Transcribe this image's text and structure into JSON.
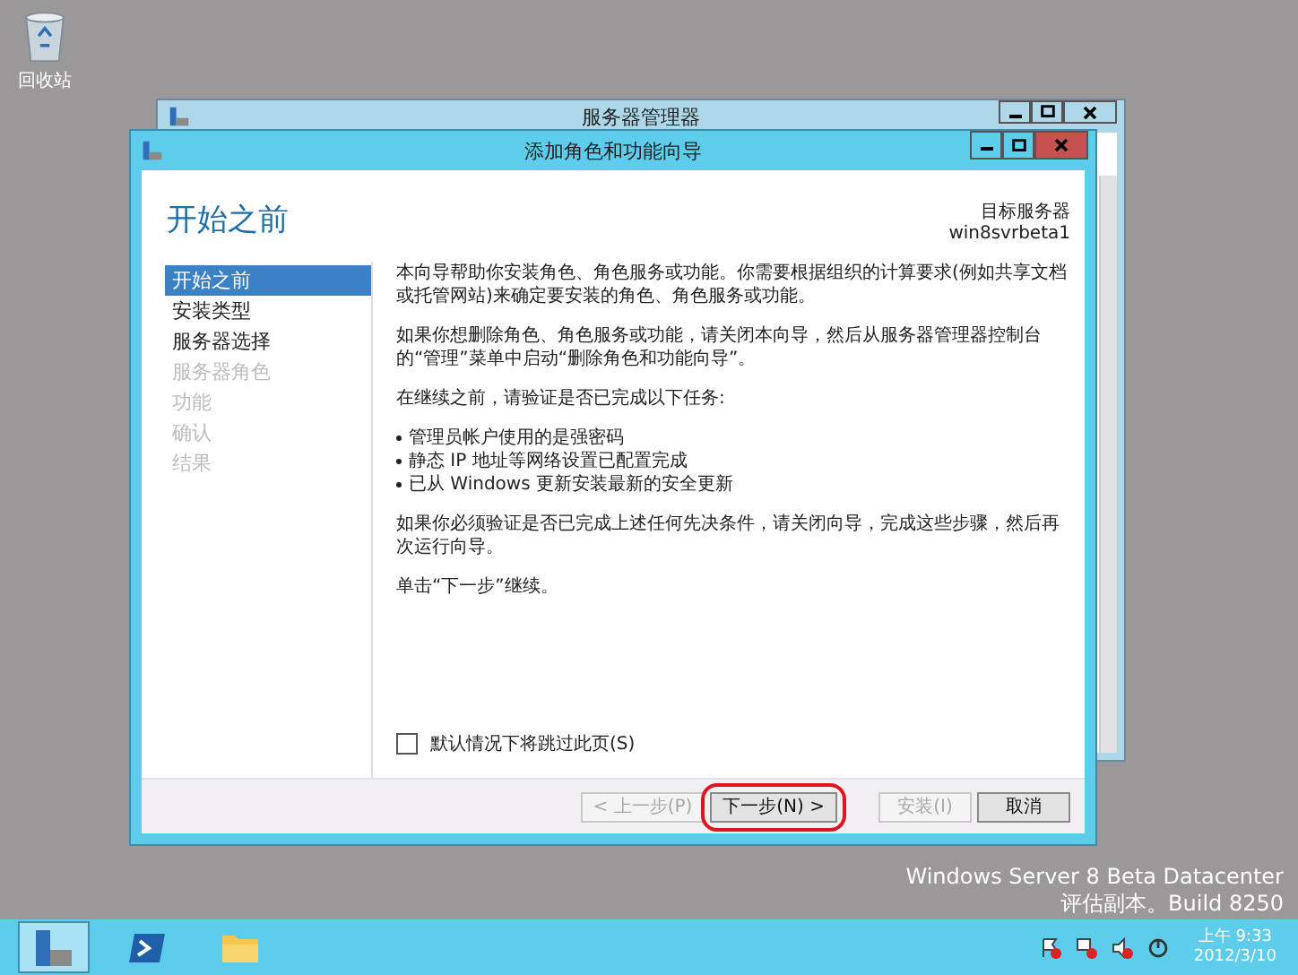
{
  "desktop": {
    "icons": [
      {
        "label": "回收站"
      }
    ]
  },
  "back_window": {
    "title": "服务器管理器"
  },
  "wizard": {
    "title": "添加角色和功能向导",
    "heading": "开始之前",
    "target_label": "目标服务器",
    "target_value": "win8svrbeta1",
    "nav": [
      {
        "label": "开始之前",
        "selected": true,
        "disabled": false
      },
      {
        "label": "安装类型",
        "selected": false,
        "disabled": false
      },
      {
        "label": "服务器选择",
        "selected": false,
        "disabled": false
      },
      {
        "label": "服务器角色",
        "selected": false,
        "disabled": true
      },
      {
        "label": "功能",
        "selected": false,
        "disabled": true
      },
      {
        "label": "确认",
        "selected": false,
        "disabled": true
      },
      {
        "label": "结果",
        "selected": false,
        "disabled": true
      }
    ],
    "content": [
      {
        "kind": "paragraph",
        "text": "本向导帮助你安装角色、角色服务或功能。你需要根据组织的计算要求(例如共享文档或托管网站)来确定要安装的角色、角色服务或功能。"
      },
      {
        "kind": "paragraph",
        "text": "如果你想删除角色、角色服务或功能，请关闭本向导，然后从服务器管理器控制台的“管理”菜单中启动“删除角色和功能向导”。"
      },
      {
        "kind": "paragraph",
        "text": "在继续之前，请验证是否已完成以下任务:"
      },
      {
        "kind": "bullets",
        "items": [
          "管理员帐户使用的是强密码",
          "静态 IP 地址等网络设置已配置完成",
          "已从 Windows 更新安装最新的安全更新"
        ]
      },
      {
        "kind": "paragraph",
        "text": "如果你必须验证是否已完成上述任何先决条件，请关闭向导，完成这些步骤，然后再次运行向导。"
      },
      {
        "kind": "paragraph",
        "text": "单击“下一步”继续。"
      }
    ],
    "skip_checkbox": {
      "label": "默认情况下将跳过此页(S)",
      "checked": false
    },
    "buttons": [
      {
        "label": "< 上一步(P)",
        "disabled": true,
        "highlighted": false
      },
      {
        "label": "下一步(N) >",
        "disabled": false,
        "highlighted": true
      },
      {
        "label": "安装(I)",
        "disabled": true,
        "highlighted": false
      },
      {
        "label": "取消",
        "disabled": false,
        "highlighted": false
      }
    ]
  },
  "edition": [
    "Windows Server 8 Beta Datacenter",
    "评估副本。Build 8250"
  ],
  "taskbar": {
    "apps": [
      {
        "kind": "server-manager",
        "selected": true
      },
      {
        "kind": "powershell",
        "selected": false
      },
      {
        "kind": "explorer",
        "selected": false
      }
    ],
    "clock": {
      "time": "上午 9:33",
      "date": "2012/3/10"
    }
  }
}
